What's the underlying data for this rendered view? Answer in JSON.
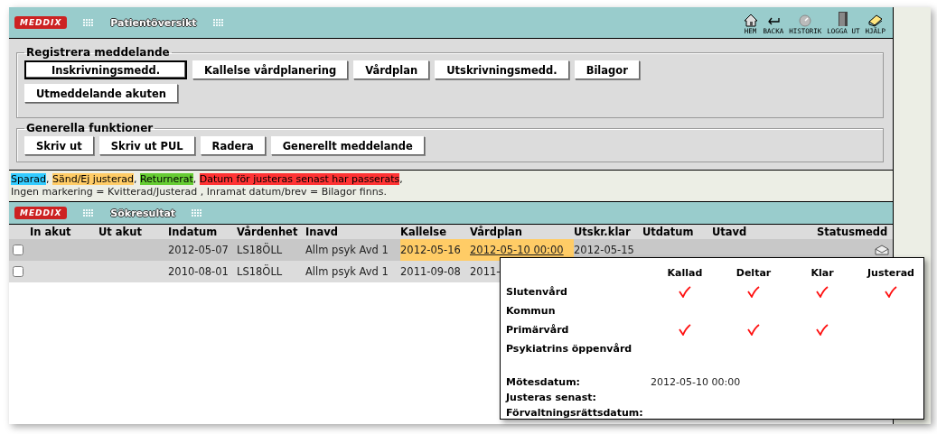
{
  "header": {
    "logo": "MEDDIX",
    "title": "Patientöversikt",
    "nav": [
      {
        "kind": "home",
        "label": "HEM"
      },
      {
        "kind": "back",
        "label": "BACKA"
      },
      {
        "kind": "history",
        "label": "HISTORIK"
      },
      {
        "kind": "logout",
        "label": "LOGGA UT"
      },
      {
        "kind": "help",
        "label": "HJÄLP"
      }
    ]
  },
  "groups": [
    {
      "title": "Registrera meddelande",
      "buttons": [
        {
          "label": "Inskrivningsmedd.",
          "focused": true
        },
        {
          "label": "Kallelse vårdplanering",
          "focused": false
        },
        {
          "label": "Vårdplan",
          "focused": false
        },
        {
          "label": "Utskrivningsmedd.",
          "focused": false
        },
        {
          "label": "Bilagor",
          "focused": false
        },
        {
          "label": "Utmeddelande akuten",
          "focused": false
        }
      ]
    },
    {
      "title": "Generella funktioner",
      "buttons": [
        {
          "label": "Skriv ut",
          "focused": false
        },
        {
          "label": "Skriv ut PUL",
          "focused": false
        },
        {
          "label": "Radera",
          "focused": false
        },
        {
          "label": "Generellt meddelande",
          "focused": false
        }
      ]
    }
  ],
  "legend": {
    "separator": ",",
    "items": [
      {
        "label": "Sparad",
        "color": "#33ccff"
      },
      {
        "label": "Sänd/Ej justerad",
        "color": "#ffcc66"
      },
      {
        "label": "Returnerat",
        "color": "#66cc33"
      },
      {
        "label": "Datum för justeras senast har passerats",
        "color": "#ff3333"
      }
    ],
    "note": "Ingen markering = Kvitterad/Justerad , Inramat datum/brev = Bilagor finns."
  },
  "results": {
    "logo": "MEDDIX",
    "title": "Sökresultat",
    "columns": [
      "In akut",
      "Ut akut",
      "Indatum",
      "Vårdenhet",
      "Inavd",
      "Kallelse",
      "Vårdplan",
      "Utskr.klar",
      "Utdatum",
      "Utavd",
      "Statusmedd"
    ],
    "rows": [
      {
        "highlighted": true,
        "checked": false,
        "message": true,
        "cells": [
          {},
          {},
          {
            "text": "2012-05-07"
          },
          {
            "text": "LS18ÖLL"
          },
          {
            "text": "Allm psyk Avd 1"
          },
          {
            "text": "2012-05-16",
            "color": "#ffcc66"
          },
          {
            "text": "2012-05-10 00:00",
            "color": "#ffcc66",
            "link": true
          },
          {
            "text": "2012-05-15"
          },
          {},
          {}
        ]
      },
      {
        "highlighted": false,
        "checked": false,
        "cells": [
          {},
          {},
          {
            "text": "2010-08-01"
          },
          {
            "text": "LS18ÖLL"
          },
          {
            "text": "Allm psyk Avd 1"
          },
          {
            "text": "2011-09-08"
          },
          {
            "text": "2011-"
          },
          {},
          {},
          {}
        ]
      }
    ]
  },
  "popup": {
    "columns": [
      "Kallad",
      "Deltar",
      "Klar",
      "Justerad"
    ],
    "rows": [
      {
        "label": "Slutenvård",
        "checks": [
          true,
          true,
          true,
          true
        ]
      },
      {
        "label": "Kommun",
        "checks": [
          false,
          false,
          false,
          false
        ]
      },
      {
        "label": "Primärvård",
        "checks": [
          true,
          true,
          true,
          false
        ]
      },
      {
        "label": "Psykiatrins öppenvård",
        "checks": [
          false,
          false,
          false,
          false
        ]
      }
    ],
    "details": [
      {
        "label": "Mötesdatum:",
        "value": "2012-05-10 00:00"
      },
      {
        "label": "Justeras senast:"
      },
      {
        "label": "Förvaltningsrättsdatum:"
      }
    ]
  }
}
